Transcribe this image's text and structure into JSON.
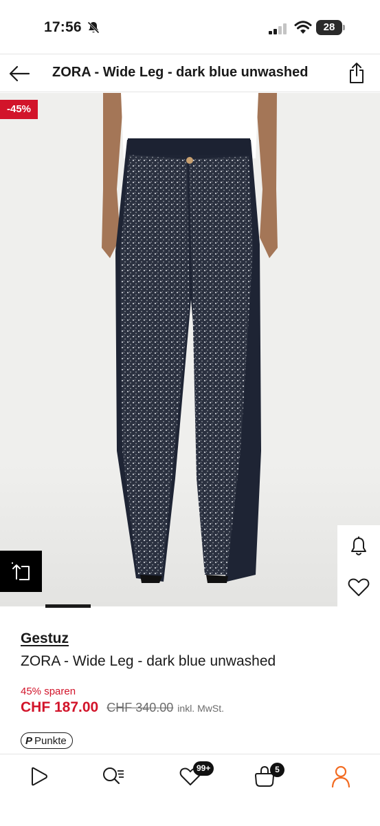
{
  "status_bar": {
    "time": "17:56",
    "battery": "28"
  },
  "header": {
    "title": "ZORA - Wide Leg - dark blue unwashed"
  },
  "image": {
    "discount_badge": "-45%"
  },
  "product": {
    "brand": "Gestuz",
    "name": "ZORA - Wide Leg - dark blue unwashed",
    "savings": "45% sparen",
    "price": "CHF 187.00",
    "old_price": "CHF 340.00",
    "vat_note": "inkl. MwSt.",
    "points_label": "Punkte",
    "points_symbol": "P"
  },
  "nav": {
    "wishlist_badge": "99+",
    "bag_badge": "5"
  },
  "colors": {
    "accent_red": "#d2142a",
    "active_nav": "#f26b21",
    "text": "#1a1a1a"
  },
  "icons": [
    "back-arrow-icon",
    "share-icon",
    "bell-icon",
    "heart-icon",
    "similar-items-icon",
    "home-play-icon",
    "search-icon",
    "wishlist-heart-icon",
    "bag-icon",
    "profile-icon"
  ]
}
